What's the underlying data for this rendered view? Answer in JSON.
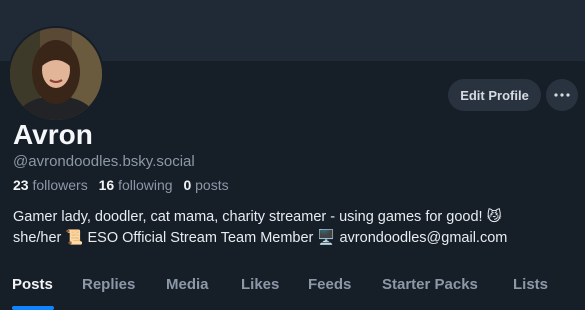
{
  "profile": {
    "display_name": "Avron",
    "handle": "@avrondoodles.bsky.social",
    "followers_count": "23",
    "followers_label": "followers",
    "following_count": "16",
    "following_label": "following",
    "posts_count": "0",
    "posts_label": "posts",
    "bio_line1": "Gamer lady, doodler, cat mama, charity streamer - using games for good! 😼",
    "bio_line2": "she/her 📜 ESO Official Stream Team Member 🖥️ avrondoodles@gmail.com"
  },
  "actions": {
    "edit_label": "Edit Profile",
    "more_icon": "ellipsis-icon"
  },
  "tabs": [
    {
      "label": "Posts",
      "active": true
    },
    {
      "label": "Replies",
      "active": false
    },
    {
      "label": "Media",
      "active": false
    },
    {
      "label": "Likes",
      "active": false
    },
    {
      "label": "Feeds",
      "active": false
    },
    {
      "label": "Starter Packs",
      "active": false
    },
    {
      "label": "Lists",
      "active": false
    }
  ],
  "colors": {
    "background": "#161e27",
    "banner": "#1f2a36",
    "accent": "#1083fe",
    "muted_text": "#8c98a8",
    "button_bg": "#29333f"
  }
}
